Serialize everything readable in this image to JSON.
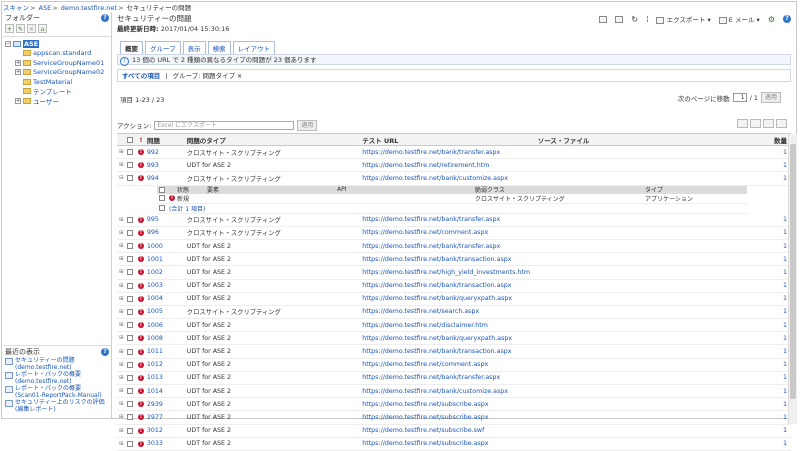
{
  "breadcrumb": [
    "スキャン",
    "ASE",
    "demo.testfire.net",
    "セキュリティーの問題"
  ],
  "left_panel": {
    "title": "フォルダー",
    "tree": [
      {
        "label": "ASE",
        "selected": true
      },
      {
        "label": "appscan.standard"
      },
      {
        "label": "ServiceGroupName01"
      },
      {
        "label": "ServiceGroupName02"
      },
      {
        "label": "TestMaterial"
      },
      {
        "label": "テンプレート"
      },
      {
        "label": "ユーザー"
      }
    ]
  },
  "recent": {
    "title": "最近の表示",
    "items": [
      "セキュリティーの問題 (demo.testfire.net)",
      "レポート・パックの概要 (demo.testfire.net)",
      "レポート・パックの概要 (Scan01-ReportPack-Manual)",
      "セキュリティー上のリスクの評価 (編集レポート)"
    ]
  },
  "main": {
    "title": "セキュリティーの問題",
    "updated_label": "最終更新日時:",
    "updated_value": "2017/01/04 15:30:16",
    "toolbar": {
      "export": "エクスポート",
      "email": "E メール"
    },
    "tabs": [
      "概要",
      "グループ",
      "表示",
      "検索",
      "レイアウト"
    ],
    "info_text": "13 個の URL で 2 種類の異なるタイプの問題が 23 個あります",
    "filter_all": "すべての項目",
    "filter_group": "グループ: 問題タイプ",
    "item_count": "項目 1-23 / 23",
    "pager": {
      "label": "次のページに移動",
      "current": "1",
      "total": "/ 1",
      "apply": "適用"
    },
    "action": {
      "label": "アクション:",
      "placeholder": "Excel にエクスポート",
      "apply": "適用"
    }
  },
  "table": {
    "columns": {
      "issue": "問題",
      "type": "問題のタイプ",
      "url": "テスト URL",
      "source": "ソース・ファイル",
      "count": "数量"
    },
    "rows": [
      {
        "id": "992",
        "type": "クロスサイト・スクリプティング",
        "url": "https://demo.testfire.net/bank/transfer.aspx",
        "count": "1"
      },
      {
        "id": "993",
        "type": "UDT for ASE 2",
        "url": "https://demo.testfire.net/retirement.htm",
        "count": "1"
      },
      {
        "id": "994",
        "type": "クロスサイト・スクリプティング",
        "url": "https://demo.testfire.net/bank/customize.aspx",
        "count": "1"
      }
    ],
    "sub": {
      "headers": {
        "status": "状態",
        "element": "要素",
        "api": "API",
        "vuln_class": "脆弱クラス",
        "kind": "タイプ"
      },
      "row": {
        "status": "新規",
        "vuln_class": "クロスサイト・スクリプティング",
        "kind": "アプリケーション"
      },
      "total": "(合計 1 項目)"
    },
    "rows2": [
      {
        "id": "995",
        "type": "クロスサイト・スクリプティング",
        "url": "https://demo.testfire.net/bank/transfer.aspx",
        "count": "1"
      },
      {
        "id": "996",
        "type": "クロスサイト・スクリプティング",
        "url": "https://demo.testfire.net/comment.aspx",
        "count": "1"
      },
      {
        "id": "1000",
        "type": "UDT for ASE 2",
        "url": "https://demo.testfire.net/bank/transfer.aspx",
        "count": "1"
      },
      {
        "id": "1001",
        "type": "UDT for ASE 2",
        "url": "https://demo.testfire.net/bank/transaction.aspx",
        "count": "1"
      },
      {
        "id": "1002",
        "type": "UDT for ASE 2",
        "url": "https://demo.testfire.net/high_yield_investments.htm",
        "count": "1"
      },
      {
        "id": "1003",
        "type": "UDT for ASE 2",
        "url": "https://demo.testfire.net/bank/transaction.aspx",
        "count": "1"
      },
      {
        "id": "1004",
        "type": "UDT for ASE 2",
        "url": "https://demo.testfire.net/bank/queryxpath.aspx",
        "count": "1"
      },
      {
        "id": "1005",
        "type": "クロスサイト・スクリプティング",
        "url": "https://demo.testfire.net/search.aspx",
        "count": "1"
      },
      {
        "id": "1006",
        "type": "UDT for ASE 2",
        "url": "https://demo.testfire.net/disclaimer.htm",
        "count": "1"
      },
      {
        "id": "1008",
        "type": "UDT for ASE 2",
        "url": "https://demo.testfire.net/bank/queryxpath.aspx",
        "count": "1"
      },
      {
        "id": "1011",
        "type": "UDT for ASE 2",
        "url": "https://demo.testfire.net/bank/transaction.aspx",
        "count": "1"
      },
      {
        "id": "1012",
        "type": "UDT for ASE 2",
        "url": "https://demo.testfire.net/comment.aspx",
        "count": "1"
      },
      {
        "id": "1013",
        "type": "UDT for ASE 2",
        "url": "https://demo.testfire.net/bank/transfer.aspx",
        "count": "1"
      },
      {
        "id": "1014",
        "type": "UDT for ASE 2",
        "url": "https://demo.testfire.net/bank/customize.aspx",
        "count": "1"
      },
      {
        "id": "2939",
        "type": "UDT for ASE 2",
        "url": "https://demo.testfire.net/subscribe.aspx",
        "count": "1"
      },
      {
        "id": "2977",
        "type": "UDT for ASE 2",
        "url": "https://demo.testfire.net/subscribe.aspx",
        "count": "1"
      },
      {
        "id": "3012",
        "type": "UDT for ASE 2",
        "url": "https://demo.testfire.net/subscribe.swf",
        "count": "1"
      },
      {
        "id": "3033",
        "type": "UDT for ASE 2",
        "url": "https://demo.testfire.net/subscribe.aspx",
        "count": "1"
      }
    ]
  }
}
